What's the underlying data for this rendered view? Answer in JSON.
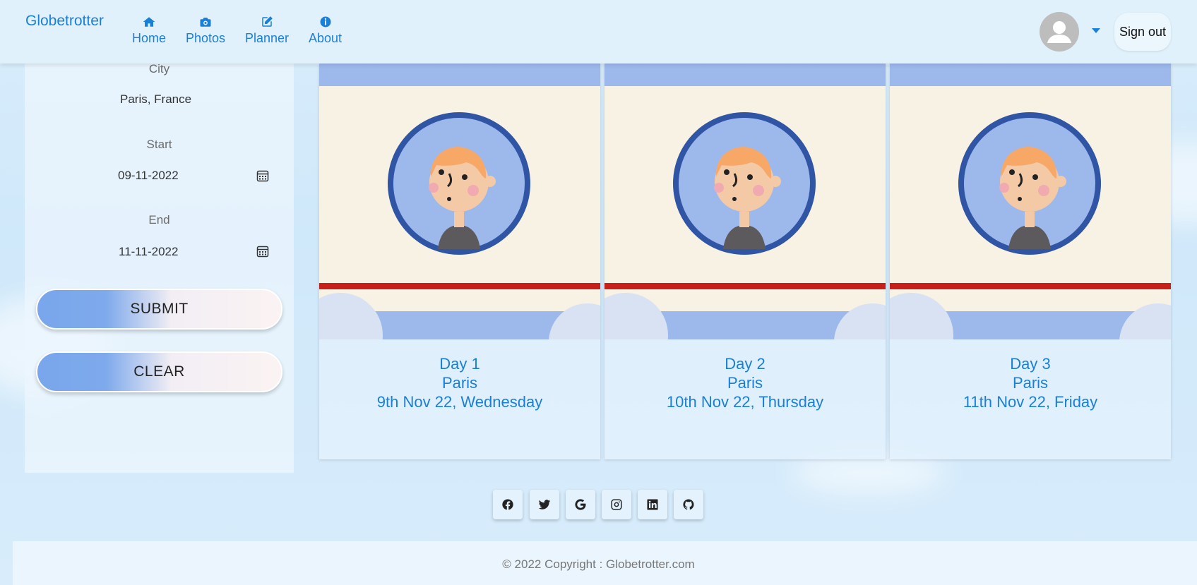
{
  "app": {
    "brand": "Globetrotter"
  },
  "nav": {
    "items": [
      {
        "label": "Home",
        "icon": "home-icon"
      },
      {
        "label": "Photos",
        "icon": "camera-icon"
      },
      {
        "label": "Planner",
        "icon": "edit-icon"
      },
      {
        "label": "About",
        "icon": "info-icon"
      }
    ],
    "user_icon": "avatar-icon",
    "dropdown_icon": "caret-down-icon",
    "signout_label": "Sign out"
  },
  "form": {
    "city_label": "City",
    "city_value": "Paris, France",
    "start_label": "Start",
    "start_value": "09-11-2022",
    "end_label": "End",
    "end_value": "11-11-2022",
    "calendar_icon": "calendar-icon",
    "submit_label": "SUBMIT",
    "clear_label": "CLEAR"
  },
  "days": [
    {
      "title": "Day 1",
      "city": "Paris",
      "date": "9th Nov 22, Wednesday"
    },
    {
      "title": "Day 2",
      "city": "Paris",
      "date": "10th Nov 22, Thursday"
    },
    {
      "title": "Day 3",
      "city": "Paris",
      "date": "11th Nov 22, Friday"
    }
  ],
  "footer": {
    "social": [
      "facebook-icon",
      "twitter-icon",
      "google-icon",
      "instagram-icon",
      "linkedin-icon",
      "github-icon"
    ],
    "copyright": "© 2022 Copyright : Globetrotter.com"
  },
  "colors": {
    "accent": "#1a7fd6",
    "button_gradient_start": "#79a6ec",
    "button_gradient_end": "#fbf3f3",
    "card_illustration_bg": "#f8f2e4",
    "card_stripe_red": "#c81f1a",
    "avatar_ring": "#2f55a4"
  }
}
